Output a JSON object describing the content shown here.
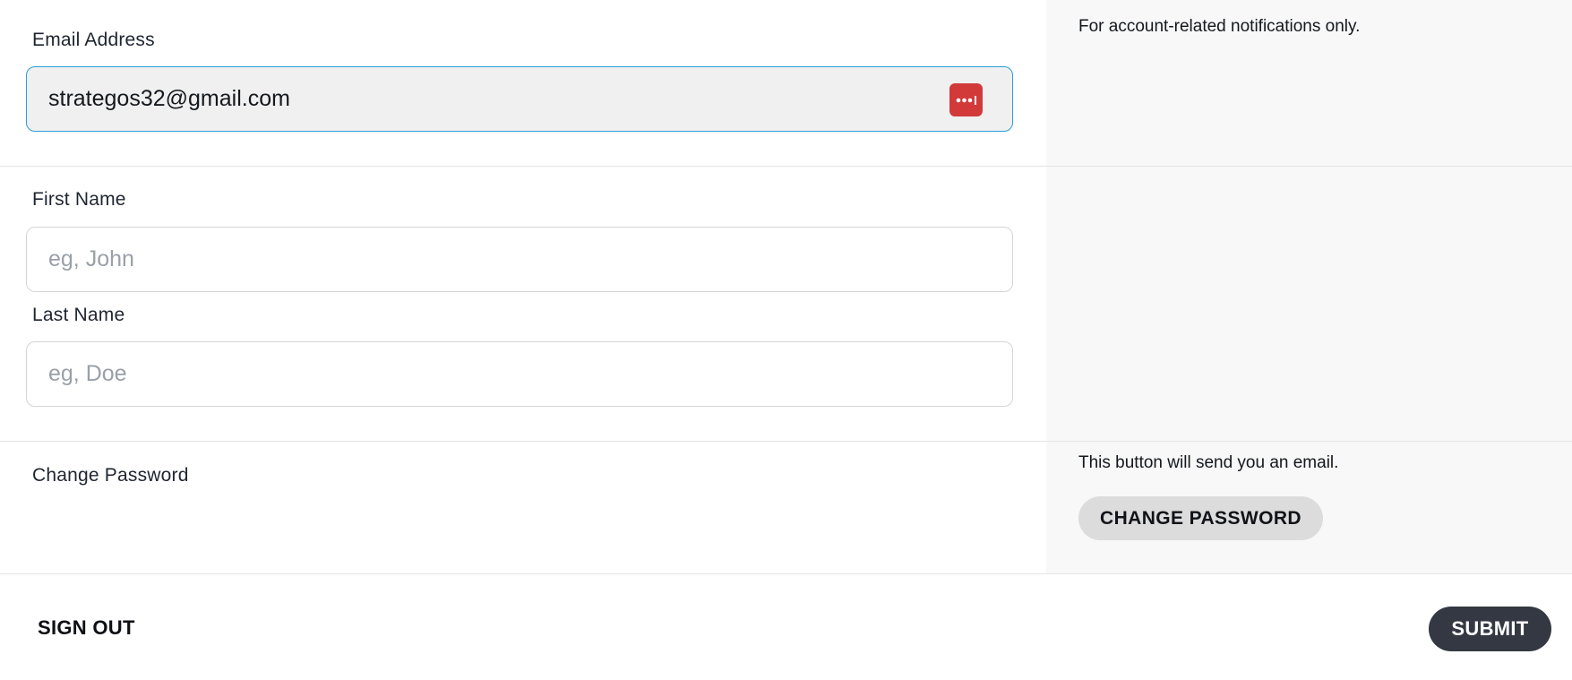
{
  "email_section": {
    "label": "Email Address",
    "value": "strategos32@gmail.com",
    "help": "For account-related notifications only.",
    "password_manager_icon": "dots-password-icon"
  },
  "name_section": {
    "first_name_label": "First Name",
    "first_name_placeholder": "eg, John",
    "first_name_value": "",
    "last_name_label": "Last Name",
    "last_name_placeholder": "eg, Doe",
    "last_name_value": ""
  },
  "password_section": {
    "label": "Change Password",
    "help": "This button will send you an email.",
    "button_label": "CHANGE PASSWORD"
  },
  "footer": {
    "sign_out_label": "SIGN OUT",
    "submit_label": "SUBMIT"
  },
  "colors": {
    "accent_border": "#2a9fd6",
    "password_manager": "#d23a3a",
    "submit_bg": "#333842",
    "panel_bg": "#f8f8f8"
  }
}
